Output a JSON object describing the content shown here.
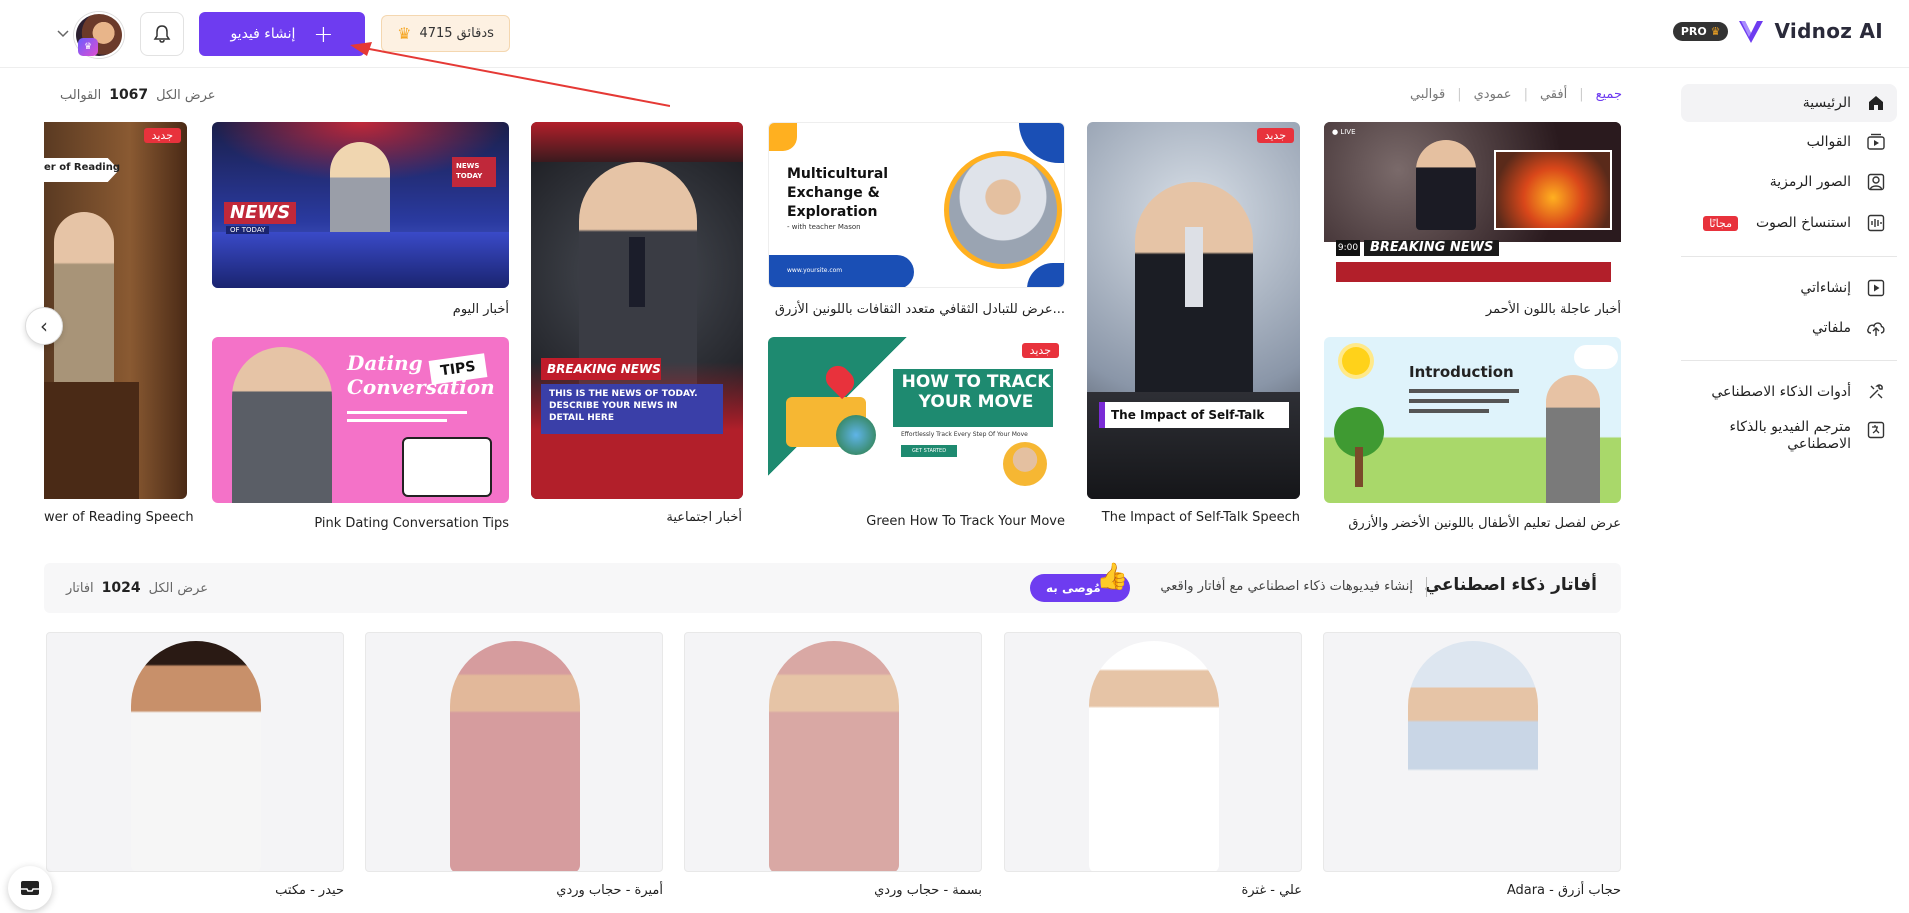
{
  "header": {
    "brand_name": "Vidnoz AI",
    "pro_badge": "PRO",
    "create_button": "إنشاء فيديو",
    "credits": "47دقائق 15s",
    "avatar_badge": "👑"
  },
  "sidebar": {
    "items": [
      {
        "label": "الرئيسية",
        "icon": "home-icon"
      },
      {
        "label": "القوالب",
        "icon": "template-icon"
      },
      {
        "label": "الصور الرمزية",
        "icon": "avatar-icon"
      },
      {
        "label": "استنساخ الصوت",
        "icon": "voice-icon",
        "badge": "مجانًا"
      },
      {
        "label": "إنشاءاتي",
        "icon": "play-icon"
      },
      {
        "label": "ملفاتي",
        "icon": "upload-icon"
      },
      {
        "label": "أدوات الذكاء الاصطناعي",
        "icon": "tools-icon"
      },
      {
        "label": "مترجم الفيديو بالذكاء الاصطناعي",
        "icon": "translate-icon"
      }
    ]
  },
  "templates": {
    "filters": [
      "جميع",
      "أفقي",
      "عمودي",
      "قوالبي"
    ],
    "view_all_label": "عرض الكل",
    "count": "1067",
    "count_unit": "القوالب",
    "new_badge": "جديد",
    "cards": [
      {
        "label": "أخبار عاجلة باللون الأحمر",
        "title": "BREAKING NEWS"
      },
      {
        "label": "عرض لفصل تعليم الأطفال باللونين الأخضر والأزرق",
        "title": "Introduction"
      },
      {
        "label": "The Impact of Self-Talk Speech",
        "title": "The Impact of Self-Talk"
      },
      {
        "label": "عرض للتبادل الثقافي متعدد الثقافات باللونين الأزرق...",
        "title": "Multicultural Exchange & Exploration",
        "sub": "- with teacher Mason",
        "site": "www.yoursite.com"
      },
      {
        "label": "Green How To Track Your Move",
        "title": "HOW TO TRACK YOUR MOVE",
        "sub": "Effortlessly Track Every Step Of Your Move",
        "cta": "GET STARTED"
      },
      {
        "label": "أخبار اجتماعية",
        "title": "BREAKING NEWS",
        "sub": "THIS IS THE NEWS OF TODAY. DESCRIBE YOUR NEWS IN DETAIL HERE"
      },
      {
        "label": "أخبار اليوم",
        "title": "NEWS",
        "sub": "OF TODAY",
        "badge": "NEWS TODAY"
      },
      {
        "label": "Pink Dating Conversation Tips",
        "title": "Dating Conversation",
        "sub": "TIPS"
      },
      {
        "label": "wer of Reading Speech",
        "title": "er of Reading"
      }
    ]
  },
  "avatars": {
    "title": "أفاتار ذكاء اصطناعي",
    "subtitle": "إنشاء فيديوهات ذكاء اصطناعي مع أفاتار واقعي",
    "recommended": "مُوصى به",
    "view_all_label": "عرض الكل",
    "count": "1024",
    "count_unit": "افاتار",
    "items": [
      {
        "name": "Adara - حجاب أزرق"
      },
      {
        "name": "علي - غترة"
      },
      {
        "name": "بسمة - حجاب وردي"
      },
      {
        "name": "أميرة - حجاب وردي"
      },
      {
        "name": "حيدر - مكتب"
      }
    ]
  }
}
